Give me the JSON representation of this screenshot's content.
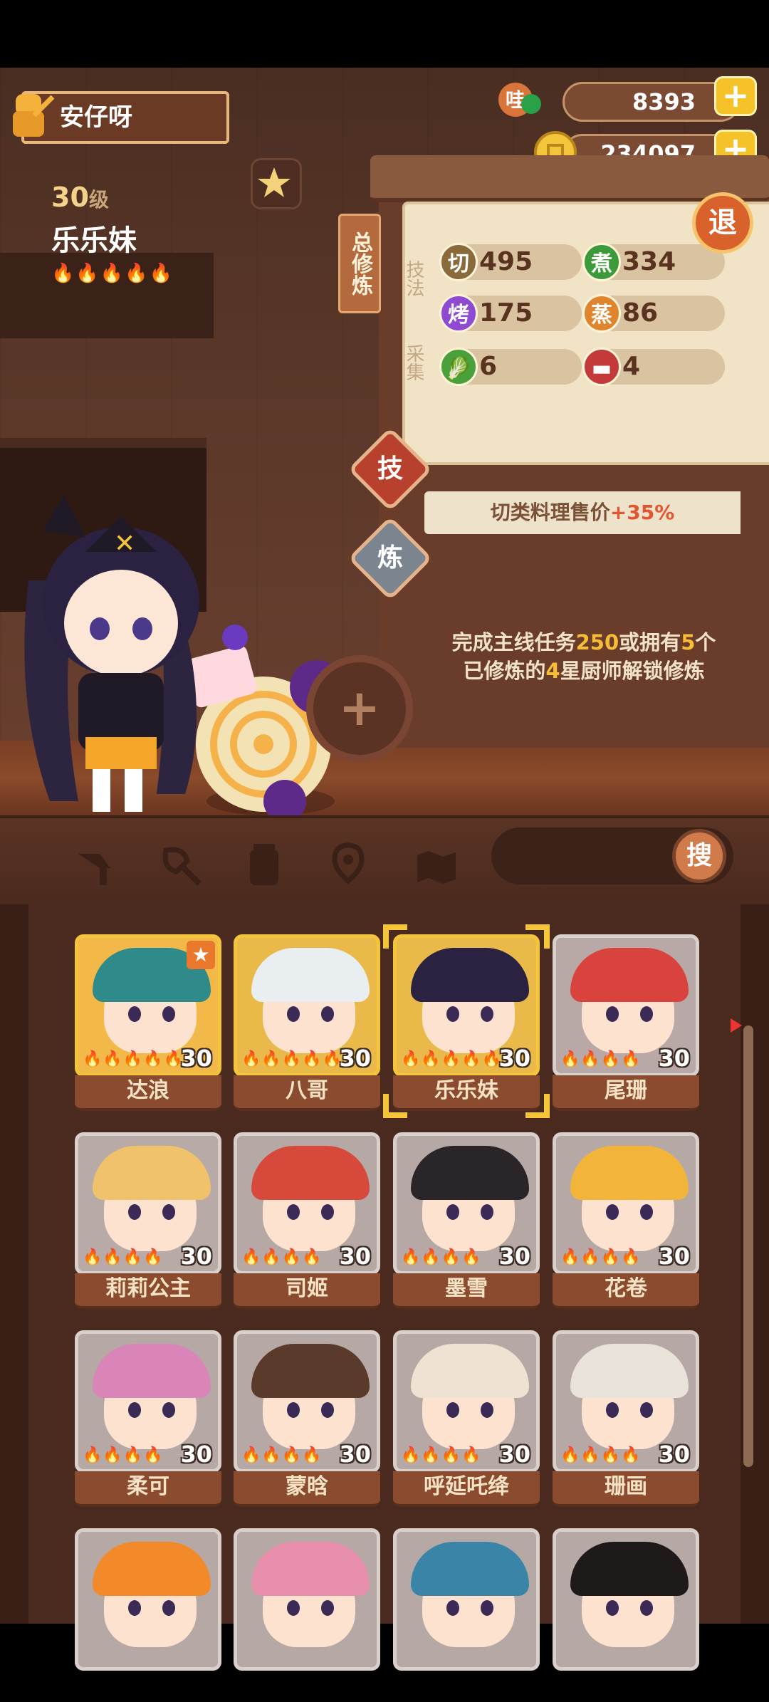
{
  "player": {
    "name": "安仔呀"
  },
  "currency": {
    "gems": "8393",
    "gems_icon": "jade-gem-icon",
    "coins": "234097",
    "coins_icon": "gold-coin-icon",
    "plus": "+"
  },
  "character": {
    "level": "30",
    "level_unit": "级",
    "name": "乐乐妹",
    "stars": 5
  },
  "panel": {
    "tag": "总修炼",
    "section_skills": "技法",
    "section_gather": "采集",
    "exit_label": "退",
    "stats": [
      {
        "icon_text": "切",
        "value": "495",
        "color": "#8a6a3a"
      },
      {
        "icon_text": "煮",
        "value": "334",
        "color": "#3d9a3a"
      },
      {
        "icon_text": "烤",
        "value": "175",
        "color": "#8e4ad0"
      },
      {
        "icon_text": "蒸",
        "value": "86",
        "color": "#e0852e"
      },
      {
        "icon": "vegetable-icon",
        "value": "6",
        "color": "#4aa03a"
      },
      {
        "icon": "meat-icon",
        "value": "4",
        "color": "#c43a3a"
      }
    ],
    "skill_tab": "技",
    "refine_tab": "炼",
    "skill_desc_prefix": "切类料理售价",
    "skill_desc_value": "+35%",
    "unlock_line1_a": "完成主线任务",
    "unlock_line1_b": "250",
    "unlock_line1_c": "或拥有",
    "unlock_line1_d": "5",
    "unlock_line1_e": "个",
    "unlock_line2_a": "已修炼的",
    "unlock_line2_b": "4",
    "unlock_line2_c": "星厨师解锁修炼",
    "add_symbol": "+"
  },
  "toolbar": {
    "search_label": "搜",
    "icons": [
      "knife-icon",
      "shovel-icon",
      "jar-icon",
      "location-icon",
      "map-icon"
    ]
  },
  "roster": [
    {
      "name": "达浪",
      "level": "30",
      "flames": 5,
      "frame": "gold",
      "hair": "#2f8a8a",
      "bg": "#f2b948",
      "starred": true
    },
    {
      "name": "八哥",
      "level": "30",
      "flames": 5,
      "frame": "gold",
      "hair": "#e9eef0",
      "bg": "#e9b94a",
      "starred": false
    },
    {
      "name": "乐乐妹",
      "level": "30",
      "flames": 5,
      "frame": "gold",
      "hair": "#2a2240",
      "bg": "#e9ba4a",
      "selected": true
    },
    {
      "name": "尾珊",
      "level": "30",
      "flames": 4,
      "frame": "silver",
      "hair": "#d9433e",
      "bg": "#b9a9a6"
    },
    {
      "name": "莉莉公主",
      "level": "30",
      "flames": 4,
      "frame": "silver",
      "hair": "#f0c26b",
      "bg": "#b8aaa7"
    },
    {
      "name": "司姬",
      "level": "30",
      "flames": 4,
      "frame": "silver",
      "hair": "#d7493a",
      "bg": "#b5a8a5"
    },
    {
      "name": "墨雪",
      "level": "30",
      "flames": 4,
      "frame": "silver",
      "hair": "#2a2528",
      "bg": "#b5a8a5"
    },
    {
      "name": "花卷",
      "level": "30",
      "flames": 4,
      "frame": "silver",
      "hair": "#f3b43a",
      "bg": "#b5a8a5"
    },
    {
      "name": "柔可",
      "level": "30",
      "flames": 4,
      "frame": "silver",
      "hair": "#d985b8",
      "bg": "#b5a8a5"
    },
    {
      "name": "蒙晗",
      "level": "30",
      "flames": 4,
      "frame": "silver",
      "hair": "#5a3a2a",
      "bg": "#b5a8a5"
    },
    {
      "name": "呼延吒绛",
      "level": "30",
      "flames": 4,
      "frame": "silver",
      "hair": "#f0e2d2",
      "bg": "#b5a8a5"
    },
    {
      "name": "珊画",
      "level": "30",
      "flames": 4,
      "frame": "silver",
      "hair": "#e9e3da",
      "bg": "#b5a8a5"
    },
    {
      "name": "",
      "level": "",
      "flames": 0,
      "frame": "silver",
      "hair": "#f28a2a",
      "bg": "#b5a8a5"
    },
    {
      "name": "",
      "level": "",
      "flames": 0,
      "frame": "silver",
      "hair": "#e98fae",
      "bg": "#b5a8a5"
    },
    {
      "name": "",
      "level": "",
      "flames": 0,
      "frame": "silver",
      "hair": "#3a84a8",
      "bg": "#b5a8a5"
    },
    {
      "name": "",
      "level": "",
      "flames": 0,
      "frame": "silver",
      "hair": "#1f1a1a",
      "bg": "#b5a8a5"
    }
  ]
}
